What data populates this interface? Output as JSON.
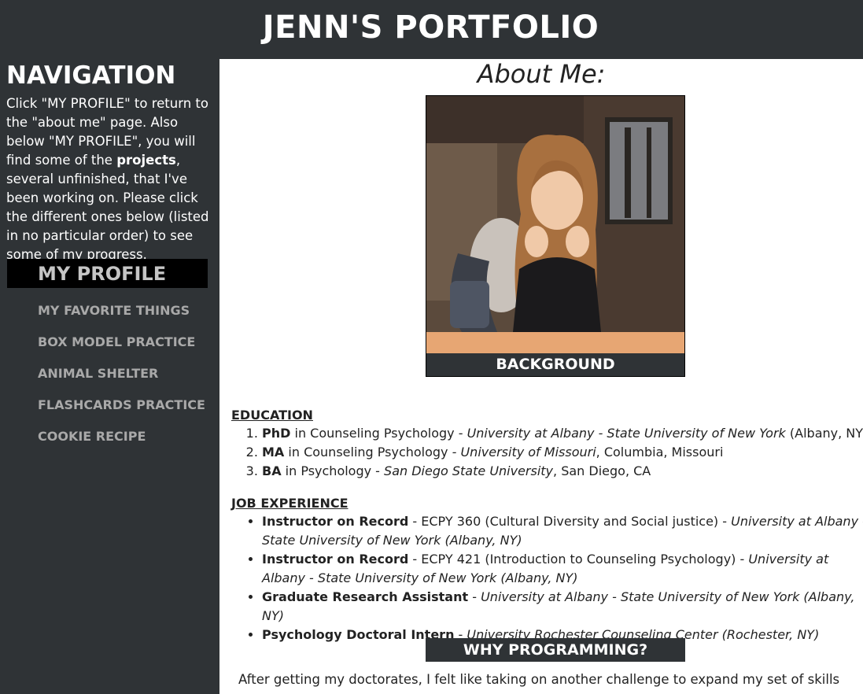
{
  "header": {
    "title": "JENN'S PORTFOLIO"
  },
  "sidebar": {
    "heading": "NAVIGATION",
    "intro_before": "Click \"MY PROFILE\" to return to the \"about me\" page. Also below \"MY PROFILE\", you will find some of the ",
    "intro_bold": "projects",
    "intro_after": ", several unfinished, that I've been working on. Please click the different ones below (listed in no particular order) to see some of my progress.",
    "active_item": "MY PROFILE",
    "items": [
      "MY FAVORITE THINGS",
      "BOX MODEL PRACTICE",
      "ANIMAL SHELTER",
      "FLASHCARDS PRACTICE",
      "COOKIE RECIPE"
    ]
  },
  "main": {
    "title": "About Me:",
    "photo_caption": "BACKGROUND",
    "education_heading": "EDUCATION",
    "education": [
      {
        "degree": "PhD",
        "field": " in Counseling Psychology - ",
        "school": "University at Albany - State University of New York",
        "location": " (Albany, NY),"
      },
      {
        "degree": "MA",
        "field": " in Counseling Psychology ",
        "school": "- University of Missouri",
        "location": ", Columbia, Missouri"
      },
      {
        "degree": "BA",
        "field": " in Psychology - ",
        "school": "San Diego State University",
        "location": ", San Diego, CA"
      }
    ],
    "job_heading": "JOB EXPERIENCE",
    "jobs": [
      {
        "role": "Instructor on Record",
        "detail": " - ECPY 360 (Cultural Diversity and Social justice) - ",
        "place": "University at Albany - State University of New York (Albany, NY)"
      },
      {
        "role": "Instructor on Record",
        "detail": " - ECPY 421 (Introduction to Counseling Psychology) - ",
        "place": "University at Albany - State University of New York (Albany, NY)"
      },
      {
        "role": "Graduate Research Assistant",
        "detail": " - ",
        "place": "University at Albany - State University of New York (Albany, NY)"
      },
      {
        "role": "Psychology Doctoral Intern",
        "detail": " - ",
        "place": "University Rochester Counseling Center (Rochester, NY)"
      }
    ],
    "why_heading": "WHY PROGRAMMING?",
    "why_text": "After getting my doctorates, I felt like taking on another challenge to expand my set of skills even more."
  }
}
